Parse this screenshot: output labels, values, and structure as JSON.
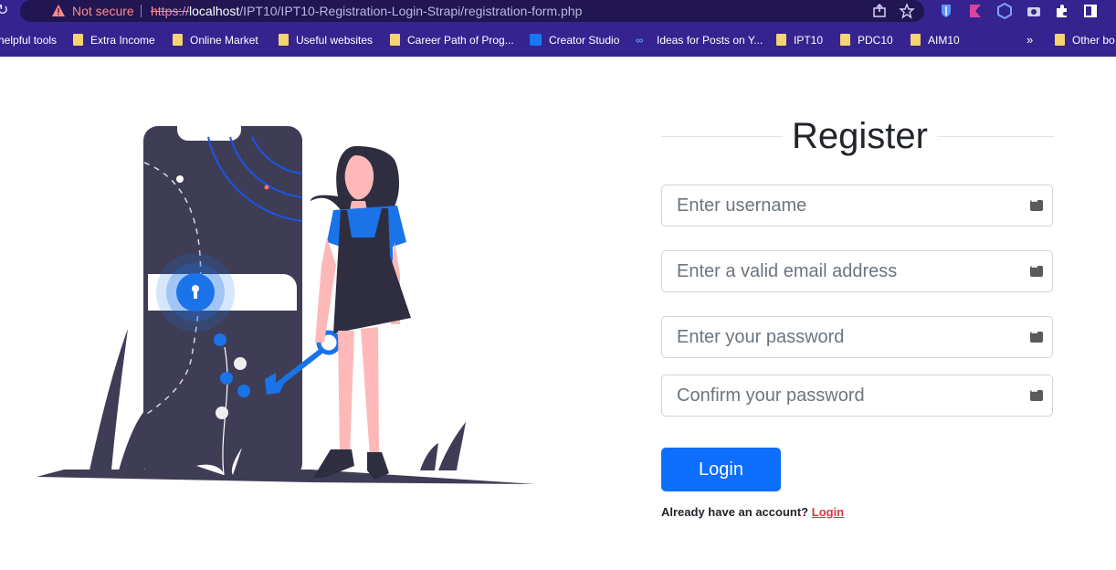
{
  "browser": {
    "security_label": "Not secure",
    "url_scheme": "https://",
    "url_host": "localhost",
    "url_path": "/IPT10/IPT10-Registration-Login-Strapi/registration-form.php"
  },
  "bookmarks": [
    "helpful tools",
    "Extra Income",
    "Online Market",
    "Useful websites",
    "Career Path of Prog...",
    "Creator Studio",
    "Ideas for Posts on Y...",
    "IPT10",
    "PDC10",
    "AIM10",
    "Other bo"
  ],
  "bookmarks_overflow": "»",
  "form": {
    "title": "Register",
    "username_placeholder": "Enter username",
    "email_placeholder": "Enter a valid email address",
    "password_placeholder": "Enter your password",
    "confirm_placeholder": "Confirm your password",
    "submit_label": "Login",
    "already_text": "Already have an account?",
    "login_link": "Login"
  },
  "colors": {
    "chrome": "#35248f",
    "primary": "#0d6efd",
    "link": "#dc3545",
    "illustration_dark": "#3f3d56",
    "illustration_accent": "#1a73e8"
  },
  "icons": [
    "reload-icon",
    "warning-icon",
    "share-icon",
    "star-icon",
    "extension-icons",
    "password-manager-icon"
  ]
}
